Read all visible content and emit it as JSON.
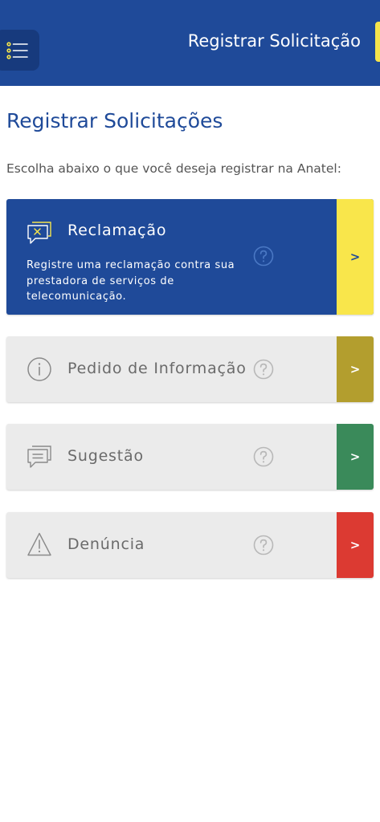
{
  "header": {
    "title": "Registrar Solicitação",
    "menu_icon": "menu-list-icon",
    "color": "#1f4a99"
  },
  "page": {
    "title": "Registrar Solicitações",
    "subtitle": "Escolha abaixo o que você deseja registrar na Anatel:"
  },
  "cards": [
    {
      "label": "Reclamação",
      "description": "Registre uma reclamação contra sua prestadora de serviços de telecomunicação.",
      "icon": "complaint-chat-icon",
      "help_icon": "help-icon",
      "arrow": ">",
      "accent_color": "#f9e64b"
    },
    {
      "label": "Pedido de Informação",
      "icon": "info-icon",
      "help_icon": "help-icon",
      "arrow": ">",
      "accent_color": "#b39e2e"
    },
    {
      "label": "Sugestão",
      "icon": "chat-icon",
      "help_icon": "help-icon",
      "arrow": ">",
      "accent_color": "#3a8a5a"
    },
    {
      "label": "Denúncia",
      "icon": "warning-icon",
      "help_icon": "help-icon",
      "arrow": ">",
      "accent_color": "#dc3a32"
    }
  ]
}
